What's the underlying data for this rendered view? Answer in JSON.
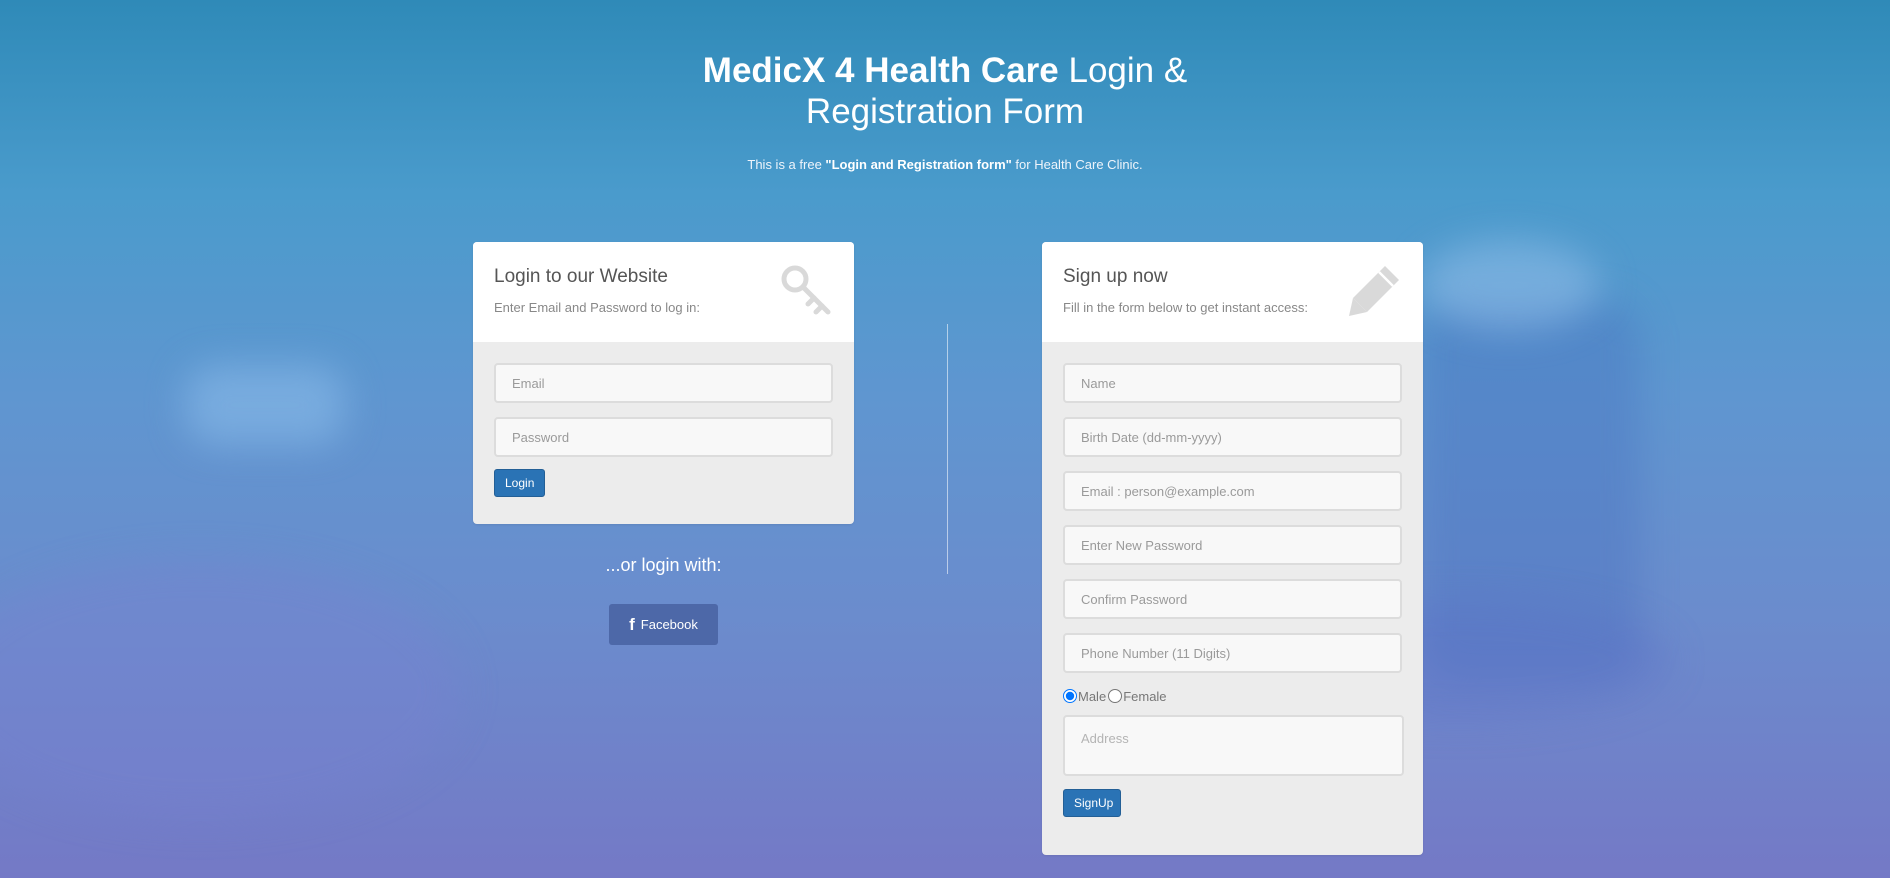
{
  "header": {
    "title_brand": "MedicX 4 Health Care",
    "title_rest": " Login & Registration Form",
    "subtitle_pre": "This is a free ",
    "subtitle_bold": "\"Login and Registration form\"",
    "subtitle_post": " for Health Care Clinic."
  },
  "login": {
    "title": "Login to our Website",
    "description": "Enter Email and Password to log in:",
    "icon": "key-icon",
    "email_placeholder": "Email",
    "password_placeholder": "Password",
    "button_label": "Login"
  },
  "social": {
    "or_text": "...or login with:",
    "facebook_icon": "f",
    "facebook_label": "Facebook"
  },
  "signup": {
    "title": "Sign up now",
    "description": "Fill in the form below to get instant access:",
    "icon": "pencil-icon",
    "name_placeholder": "Name",
    "birthdate_placeholder": "Birth Date (dd-mm-yyyy)",
    "email_placeholder": "Email : person@example.com",
    "new_password_placeholder": "Enter New Password",
    "confirm_password_placeholder": "Confirm Password",
    "phone_placeholder": "Phone Number (11 Digits)",
    "gender_options": [
      "Male",
      "Female"
    ],
    "gender_selected": "Male",
    "address_placeholder": "Address",
    "button_label": "SignUp"
  },
  "colors": {
    "primary_button": "#2a73b5",
    "facebook": "#4d68a8",
    "panel_bg": "#ececec"
  }
}
